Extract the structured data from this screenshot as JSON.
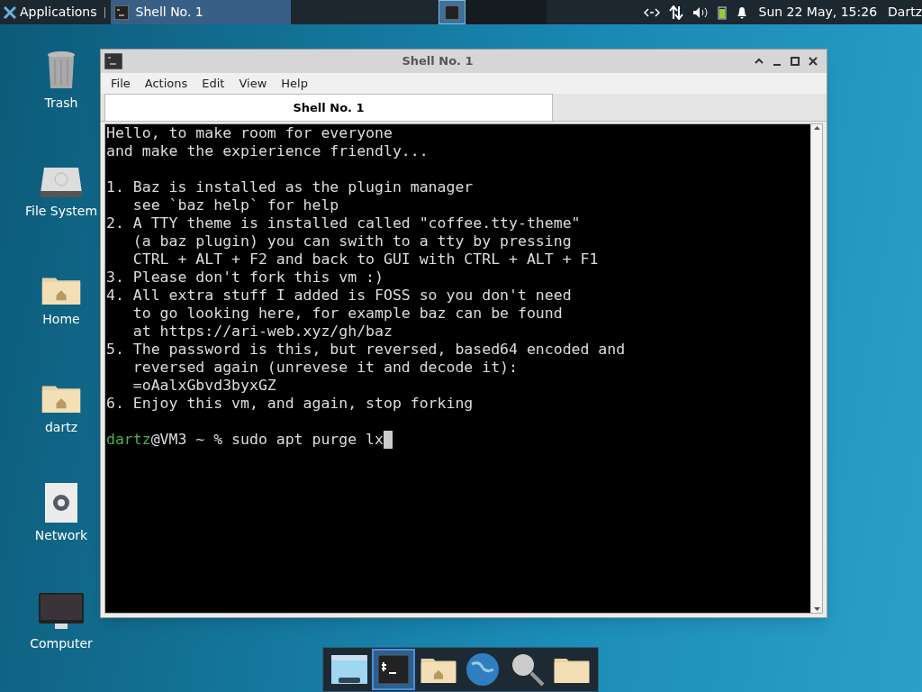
{
  "top_panel": {
    "menu_button": "Applications",
    "tasks": [
      {
        "label": "Shell No. 1",
        "selected": true
      }
    ],
    "workspaces": [
      {
        "selected": true
      },
      {
        "selected": false
      },
      {
        "selected": false
      },
      {
        "selected": false
      }
    ],
    "clock": "Sun 22 May, 15:26",
    "user": "Dartz"
  },
  "desktop_icons": [
    {
      "kind": "trash",
      "label": "Trash"
    },
    {
      "kind": "drive",
      "label": "File System"
    },
    {
      "kind": "home",
      "label": "Home"
    },
    {
      "kind": "home",
      "label": "dartz"
    },
    {
      "kind": "network",
      "label": "Network"
    },
    {
      "kind": "computer",
      "label": "Computer"
    }
  ],
  "window": {
    "title": "Shell No. 1",
    "menu": [
      "File",
      "Actions",
      "Edit",
      "View",
      "Help"
    ],
    "tabs": [
      {
        "label": "Shell No. 1",
        "selected": true
      }
    ],
    "terminal": {
      "blocks": [
        [
          "Hello, to make room for everyone",
          "and make the expierience friendly..."
        ],
        [
          "1. Baz is installed as the plugin manager",
          "   see `baz help` for help",
          "2. A TTY theme is installed called \"coffee.tty-theme\"",
          "   (a baz plugin) you can swith to a tty by pressing",
          "   CTRL + ALT + F2 and back to GUI with CTRL + ALT + F1",
          "3. Please don't fork this vm :)",
          "4. All extra stuff I added is FOSS so you don't need",
          "   to go looking here, for example baz can be found",
          "   at https://ari-web.xyz/gh/baz",
          "5. The password is this, but reversed, based64 encoded and",
          "   reversed again (unrevese it and decode it):",
          "   =oAalxGbvd3byxGZ",
          "6. Enjoy this vm, and again, stop forking"
        ]
      ],
      "prompt": {
        "user": "dartz",
        "host": "@VM3 ~ % ",
        "command": "sudo apt purge lx"
      }
    }
  },
  "dock": [
    {
      "kind": "screen",
      "selected": false
    },
    {
      "kind": "terminal",
      "selected": true
    },
    {
      "kind": "home",
      "selected": false
    },
    {
      "kind": "globe",
      "selected": false
    },
    {
      "kind": "search",
      "selected": false
    },
    {
      "kind": "folder",
      "selected": false
    }
  ]
}
